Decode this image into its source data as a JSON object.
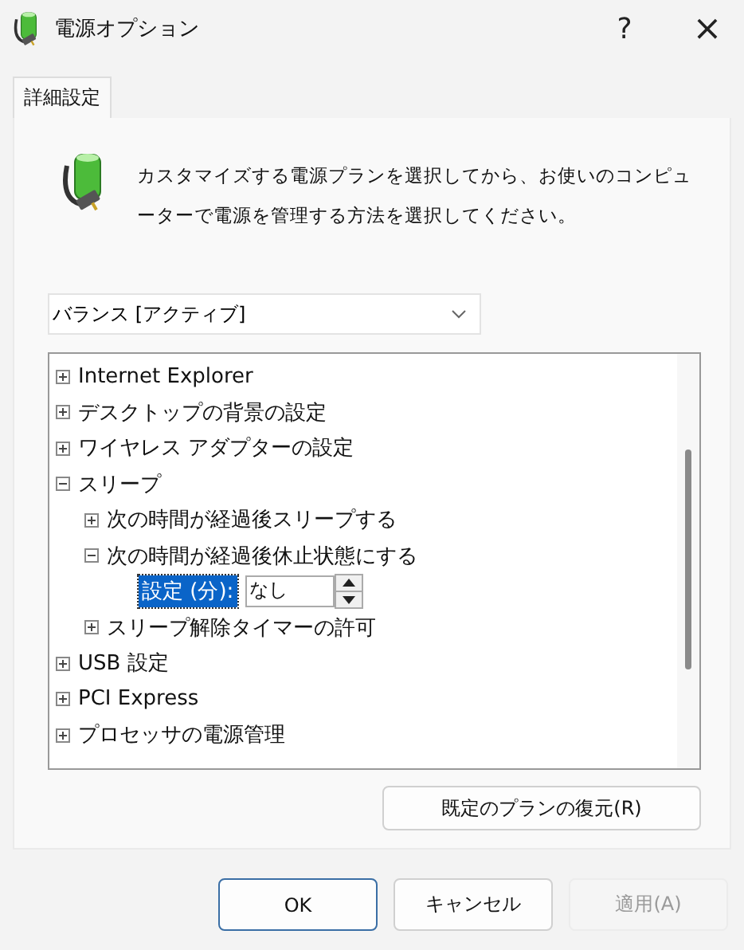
{
  "window": {
    "title": "電源オプション",
    "help": "?",
    "close": "×"
  },
  "tabs": [
    {
      "label": "詳細設定",
      "selected": true
    }
  ],
  "description": "カスタマイズする電源プランを選択してから、お使いのコンピューターで電源を管理する方法を選択してください。",
  "plan_dropdown": {
    "value": "バランス [アクティブ]"
  },
  "tree": [
    {
      "kind": "group",
      "label": "Internet Explorer",
      "expanded": false
    },
    {
      "kind": "group",
      "label": "デスクトップの背景の設定",
      "expanded": false
    },
    {
      "kind": "group",
      "label": "ワイヤレス アダプターの設定",
      "expanded": false
    },
    {
      "kind": "group",
      "label": "スリープ",
      "expanded": true,
      "children": [
        {
          "kind": "group",
          "label": "次の時間が経過後スリープする",
          "expanded": false
        },
        {
          "kind": "group",
          "label": "次の時間が経過後休止状態にする",
          "expanded": true,
          "children": [
            {
              "kind": "setting",
              "label": "設定 (分):",
              "selected": true,
              "value": "なし"
            }
          ]
        },
        {
          "kind": "group",
          "label": "スリープ解除タイマーの許可",
          "expanded": false
        }
      ]
    },
    {
      "kind": "group",
      "label": "USB 設定",
      "expanded": false
    },
    {
      "kind": "group",
      "label": "PCI Express",
      "expanded": false
    },
    {
      "kind": "group",
      "label": "プロセッサの電源管理",
      "expanded": false
    }
  ],
  "restore_button": "既定のプランの復元(R)",
  "buttons": [
    {
      "label": "OK",
      "kind": "default",
      "disabled": false
    },
    {
      "label": "キャンセル",
      "kind": "normal",
      "disabled": false
    },
    {
      "label": "適用(A)",
      "kind": "normal",
      "disabled": true
    }
  ]
}
